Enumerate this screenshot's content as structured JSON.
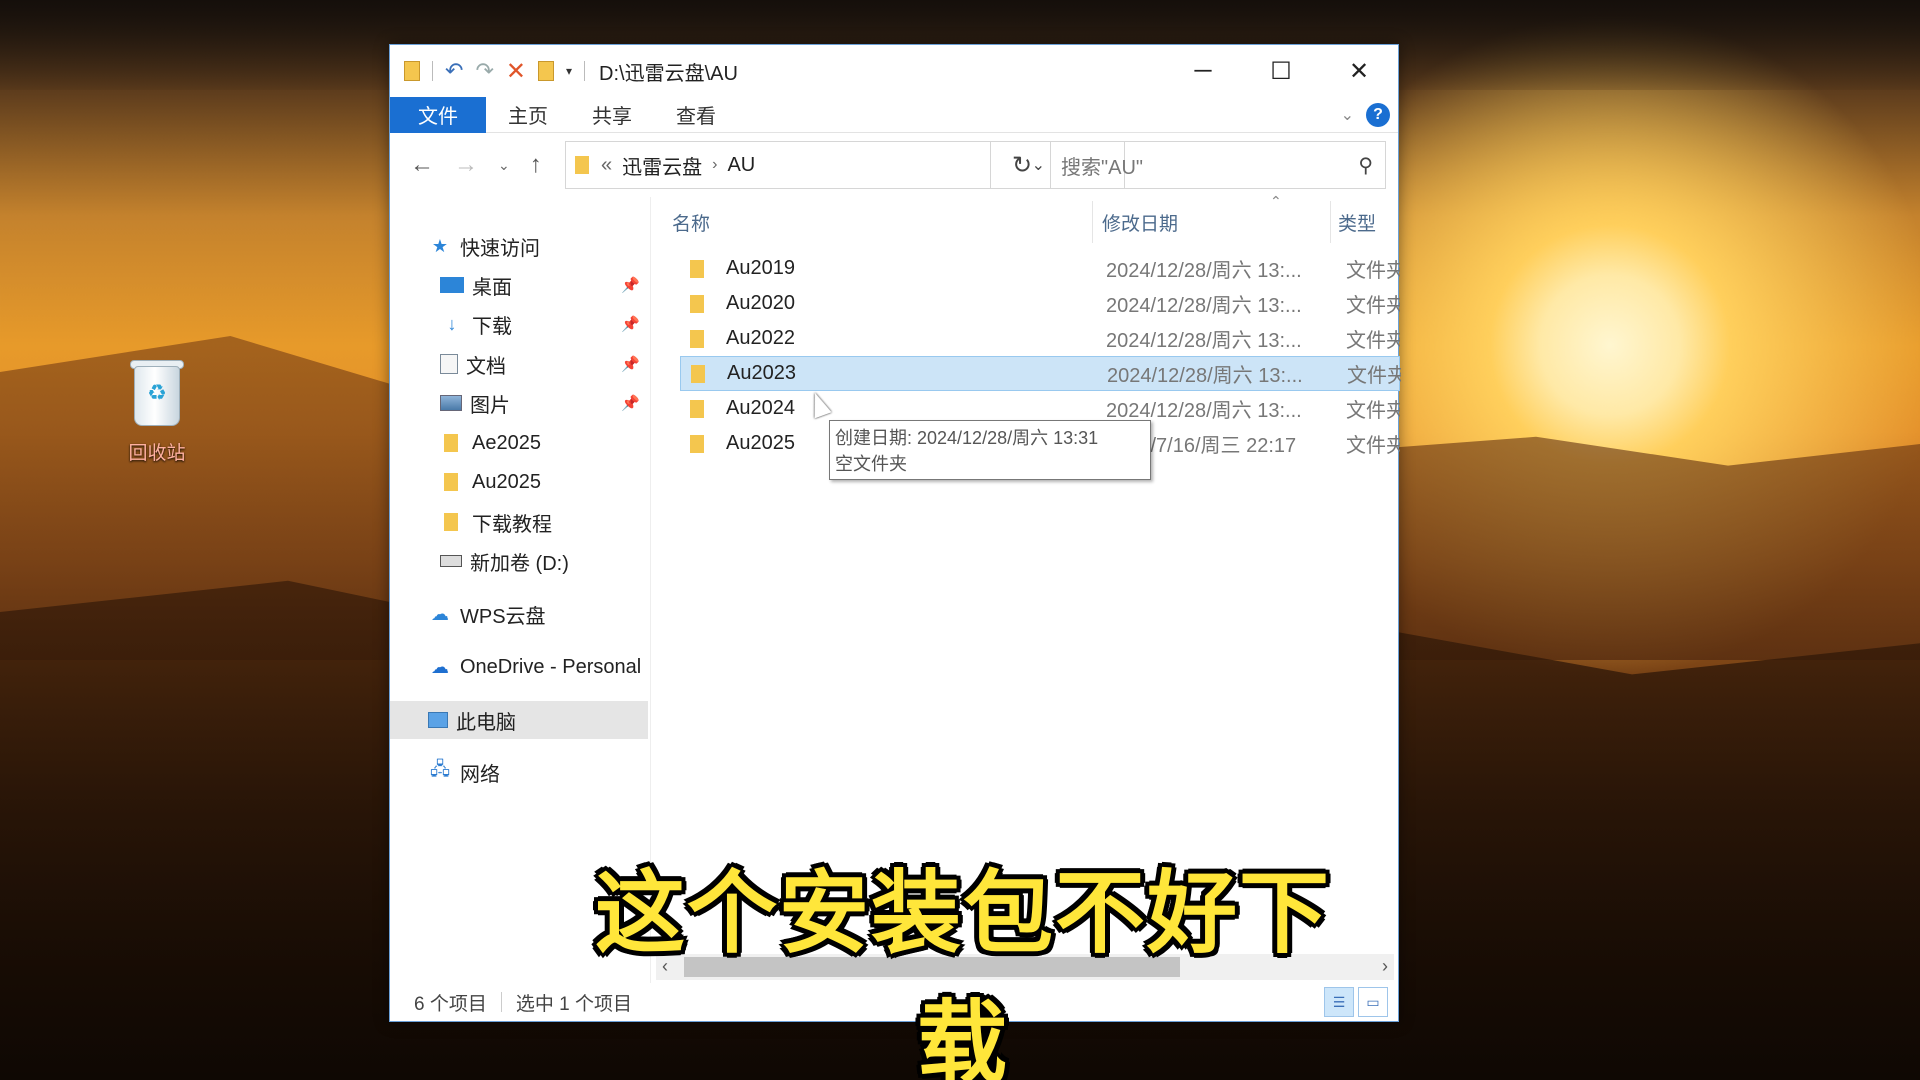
{
  "desktop": {
    "recycle_bin_label": "回收站"
  },
  "window": {
    "title": "D:\\迅雷云盘\\AU",
    "controls": {
      "minimize": "─",
      "maximize": "☐",
      "close": "✕"
    }
  },
  "ribbon": {
    "tabs": [
      "文件",
      "主页",
      "共享",
      "查看"
    ],
    "help": "?"
  },
  "address": {
    "crumbs": [
      "迅雷云盘",
      "AU"
    ],
    "prefix": "«",
    "search_placeholder": "搜索\"AU\""
  },
  "sidebar": {
    "quick_access": "快速访问",
    "items": [
      {
        "label": "桌面",
        "icon": "desktop-icon",
        "pinned": true
      },
      {
        "label": "下载",
        "icon": "download-icon",
        "pinned": true
      },
      {
        "label": "文档",
        "icon": "document-icon",
        "pinned": true
      },
      {
        "label": "图片",
        "icon": "picture-icon",
        "pinned": true
      },
      {
        "label": "Ae2025",
        "icon": "folder-icon",
        "pinned": false
      },
      {
        "label": "Au2025",
        "icon": "folder-icon",
        "pinned": false
      },
      {
        "label": "下载教程",
        "icon": "folder-icon",
        "pinned": false
      },
      {
        "label": "新加卷 (D:)",
        "icon": "drive-icon",
        "pinned": false
      }
    ],
    "wps": "WPS云盘",
    "onedrive": "OneDrive - Personal",
    "this_pc": "此电脑",
    "network": "网络"
  },
  "columns": {
    "name": "名称",
    "date": "修改日期",
    "type": "类型"
  },
  "files": [
    {
      "name": "Au2019",
      "date": "2024/12/28/周六 13:...",
      "type": "文件夹"
    },
    {
      "name": "Au2020",
      "date": "2024/12/28/周六 13:...",
      "type": "文件夹"
    },
    {
      "name": "Au2022",
      "date": "2024/12/28/周六 13:...",
      "type": "文件夹"
    },
    {
      "name": "Au2023",
      "date": "2024/12/28/周六 13:...",
      "type": "文件夹",
      "selected": true
    },
    {
      "name": "Au2024",
      "date": "2024/12/28/周六 13:...",
      "type": "文件夹"
    },
    {
      "name": "Au2025",
      "date": "2025/7/16/周三 22:17",
      "type": "文件夹"
    }
  ],
  "tooltip": {
    "line1": "创建日期: 2024/12/28/周六 13:31",
    "line2": "空文件夹"
  },
  "status": {
    "count": "6 个项目",
    "selected": "选中 1 个项目"
  },
  "subtitle": "这个安装包不好下载"
}
